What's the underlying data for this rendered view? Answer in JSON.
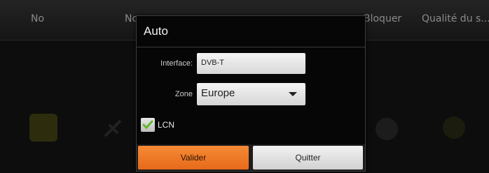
{
  "background": {
    "tabs": [
      "No",
      "No",
      "Bloquer",
      "Qualité du s..."
    ],
    "icons": [
      "tv-icon",
      "satellite-icon",
      "football-icon",
      "radio-icon"
    ]
  },
  "dialog": {
    "title": "Auto",
    "interface": {
      "label": "Interface:",
      "value": "DVB-T"
    },
    "zone": {
      "label": "Zone",
      "selected": "Europe"
    },
    "lcn": {
      "label": "LCN",
      "checked": true
    },
    "buttons": {
      "ok": "Valider",
      "quit": "Quitter"
    }
  },
  "colors": {
    "accent_orange": "#ef7a2a",
    "check_green": "#63b92c"
  }
}
